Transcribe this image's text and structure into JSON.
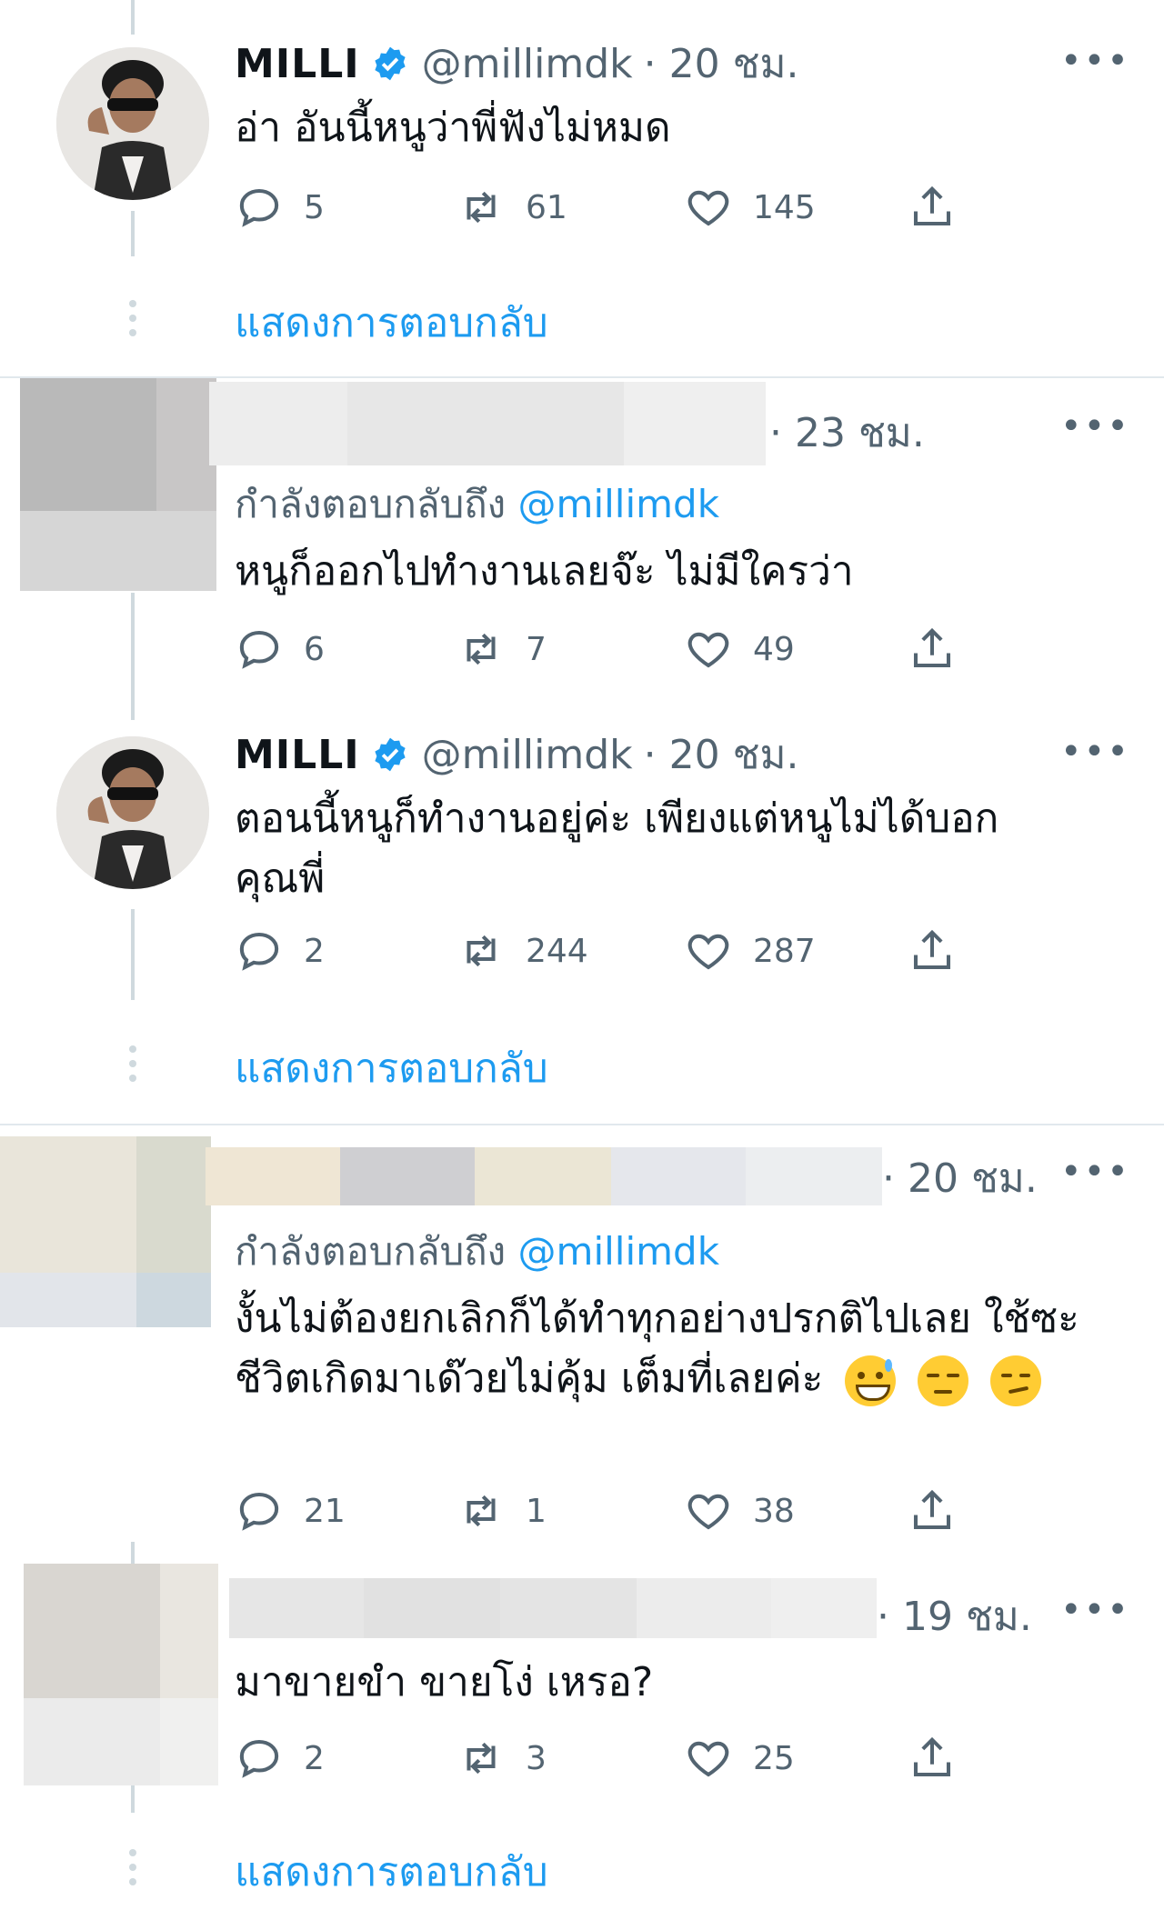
{
  "tweets": [
    {
      "name": "MILLI",
      "handle": "@millimdk",
      "time": "· 20 ชม.",
      "text": "อ่า อันนี้หนูว่าพี่ฟังไม่หมด",
      "replies": "5",
      "retweets": "61",
      "likes": "145",
      "show_replies": "แสดงการตอบกลับ"
    },
    {
      "time": "· 23 ชม.",
      "replying_prefix": "กำลังตอบกลับถึง",
      "replying_to": "@millimdk",
      "text": "หนูก็ออกไปทำงานเลยจ๊ะ ไม่มีใครว่า",
      "replies": "6",
      "retweets": "7",
      "likes": "49"
    },
    {
      "name": "MILLI",
      "handle": "@millimdk",
      "time": "· 20 ชม.",
      "text": "ตอนนี้หนูก็ทำงานอยู่ค่ะ เพียงแต่หนูไม่ได้บอกคุณพี่",
      "replies": "2",
      "retweets": "244",
      "likes": "287",
      "show_replies": "แสดงการตอบกลับ"
    },
    {
      "time": "· 20 ชม.",
      "replying_prefix": "กำลังตอบกลับถึง",
      "replying_to": "@millimdk",
      "text": "งั้นไม่ต้องยกเลิกก็ได้ทำทุกอย่างปรกติไปเลย ใช้ซะชีวิตเกิดมาเด๊วยไม่คุ้ม เต็มที่เลยค่ะ",
      "emojis": [
        "grinning-sweat-emoji",
        "unamused-emoji",
        "smirking-emoji"
      ],
      "replies": "21",
      "retweets": "1",
      "likes": "38"
    },
    {
      "time": "· 19 ชม.",
      "text": "มาขายขำ ขายโง่ เหรอ?",
      "replies": "2",
      "retweets": "3",
      "likes": "25",
      "show_replies": "แสดงการตอบกลับ"
    }
  ],
  "more_icon": "•••",
  "colors": {
    "accent": "#1d9bf0",
    "muted": "#536471",
    "text": "#0f1419"
  }
}
